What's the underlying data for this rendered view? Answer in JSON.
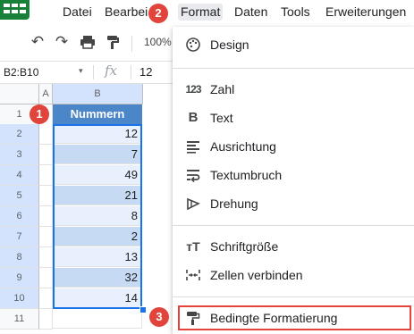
{
  "menu": {
    "items": [
      "Datei",
      "Bearbei",
      "Format",
      "Daten",
      "Tools",
      "Erweiterungen"
    ]
  },
  "toolbar": {
    "icons": [
      "undo-icon",
      "redo-icon",
      "print-icon",
      "paint-format-icon"
    ],
    "zoom": "100%"
  },
  "formula_bar": {
    "name_box": "B2:B10",
    "fx_label": "fx",
    "value": "12"
  },
  "grid": {
    "columns": [
      "A",
      "B"
    ],
    "row_numbers": [
      "1",
      "2",
      "3",
      "4",
      "5",
      "6",
      "7",
      "8",
      "9",
      "10",
      "11"
    ],
    "header": "Nummern",
    "values": [
      "12",
      "7",
      "49",
      "21",
      "8",
      "2",
      "13",
      "32",
      "14"
    ]
  },
  "format_menu": {
    "items": [
      {
        "label": "Design",
        "icon": "palette-icon"
      },
      {
        "label": "Zahl",
        "icon": "number-format-icon"
      },
      {
        "label": "Text",
        "icon": "bold-icon"
      },
      {
        "label": "Ausrichtung",
        "icon": "align-icon"
      },
      {
        "label": "Textumbruch",
        "icon": "text-wrap-icon"
      },
      {
        "label": "Drehung",
        "icon": "rotation-icon"
      },
      {
        "label": "Schriftgröße",
        "icon": "font-size-icon"
      },
      {
        "label": "Zellen verbinden",
        "icon": "merge-cells-icon"
      },
      {
        "label": "Bedingte Formatierung",
        "icon": "paint-roller-icon"
      }
    ]
  },
  "callouts": [
    "1",
    "2",
    "3"
  ],
  "colors": {
    "header_fill": "#4a86c8",
    "band_light": "#e8f0fe",
    "band_dark": "#c6dbf3",
    "callout": "#e0443b",
    "selection": "#1a73e8"
  }
}
